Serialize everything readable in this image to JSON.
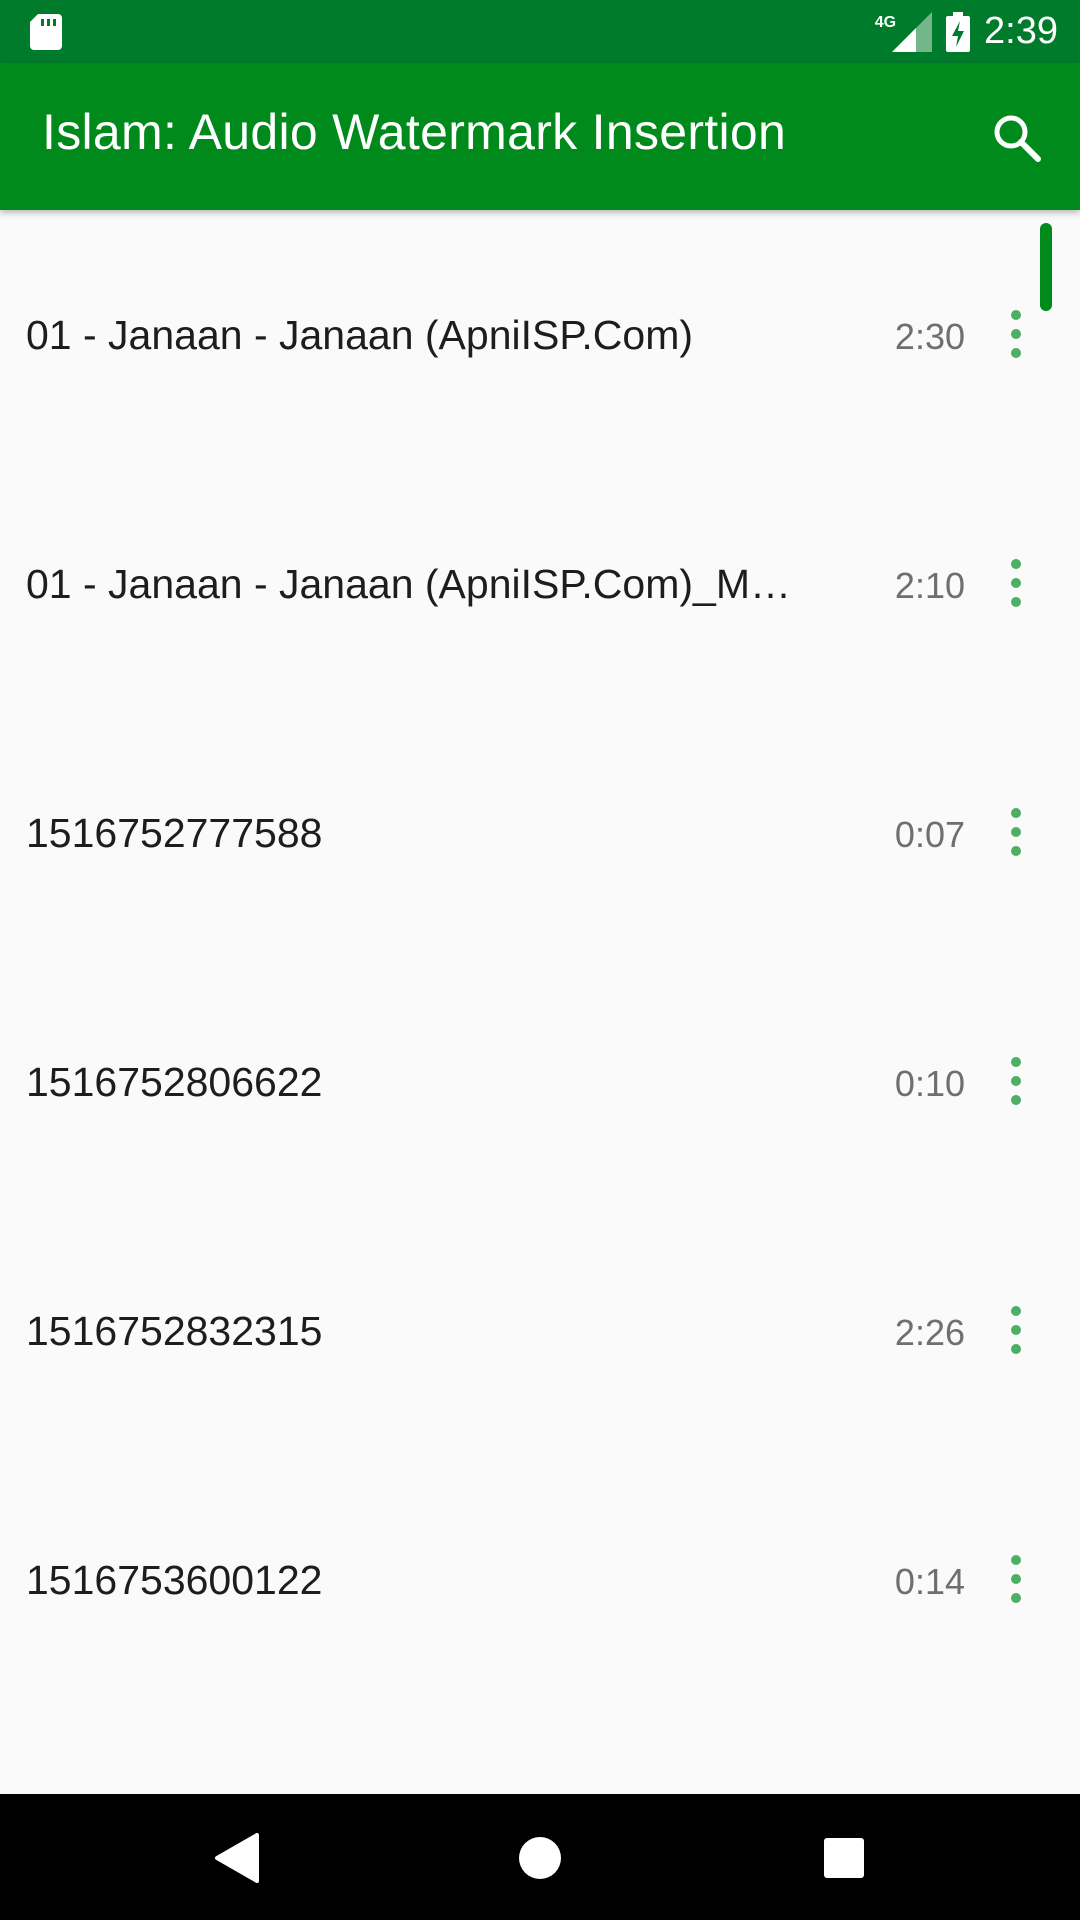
{
  "status_bar": {
    "network": "4G",
    "time": "2:39",
    "icons": [
      "sd-card-icon",
      "signal-icon",
      "battery-charging-icon"
    ]
  },
  "app_bar": {
    "title": "Islam: Audio Watermark Insertion",
    "search_icon": "search-icon"
  },
  "tracks": [
    {
      "title": "01 - Janaan - Janaan (ApniISP.Com)",
      "duration": "2:30"
    },
    {
      "title": "01 - Janaan - Janaan (ApniISP.Com)_Mar...",
      "duration": "2:10"
    },
    {
      "title": "1516752777588",
      "duration": "0:07"
    },
    {
      "title": "1516752806622",
      "duration": "0:10"
    },
    {
      "title": "1516752832315",
      "duration": "2:26"
    },
    {
      "title": "1516753600122",
      "duration": "0:14"
    }
  ],
  "nav_bar": {
    "icons": [
      "back-icon",
      "home-icon",
      "recents-icon"
    ]
  },
  "colors": {
    "status_bar": "#007a2b",
    "app_bar": "#008a1c",
    "accent": "#4caf63"
  }
}
